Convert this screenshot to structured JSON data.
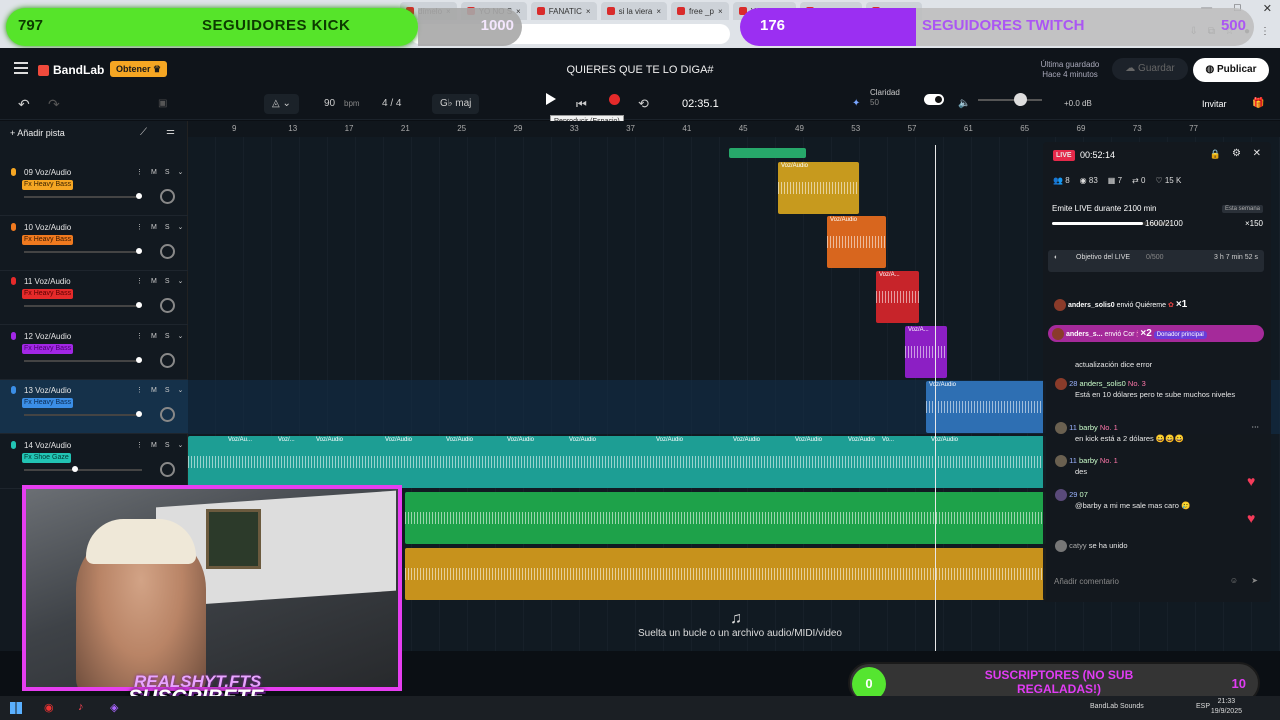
{
  "overlay": {
    "kick": {
      "count": "797",
      "label": "SEGUIDORES KICK",
      "goal": "1000"
    },
    "twitch": {
      "count": "176",
      "label": "SEGUIDORES TWITCH",
      "goal": "500"
    },
    "subs": {
      "count": "0",
      "label": "SUSCRIPTORES (NO SUB REGALADAS!)",
      "goal": "10"
    },
    "cam_handle": "REALSHYT.FTS",
    "cam_cta": "SUSCRIBETE"
  },
  "browser": {
    "tabs": [
      "dímelo",
      "YO NO S",
      "FANATIC",
      "si la viera",
      "free _p",
      "YO SOY",
      "VEN - V",
      "WASH"
    ]
  },
  "header": {
    "brand": "BandLab",
    "get_button": "Obtener",
    "title": "QUIERES QUE TE LO DIGA#",
    "saved_line1": "Última guardado",
    "saved_line2": "Hace 4 minutos",
    "save_button": "Guardar",
    "publish_button": "Publicar"
  },
  "transport": {
    "bpm_value": "90",
    "bpm_unit": "bpm",
    "time_signature": "4 / 4",
    "key": "G♭ maj",
    "time": "02:35.1",
    "tooltip": "Reproducir (Espacio)",
    "clarity_label": "Claridad",
    "clarity_value": "50",
    "volume_db": "+0.0 dB",
    "invite": "Invitar"
  },
  "add_track": "Añadir pista",
  "ruler": [
    "9",
    "13",
    "17",
    "21",
    "25",
    "29",
    "33",
    "37",
    "41",
    "45",
    "49",
    "53",
    "57",
    "61",
    "65",
    "69",
    "73",
    "77"
  ],
  "tracks": [
    {
      "num": "09",
      "name": "Voz/Audio",
      "fx": "Fx Heavy Bass",
      "fx_bg": "#f5a623",
      "fx_fg": "#3a2200",
      "mic": "#f5a623",
      "fader": 0.98
    },
    {
      "num": "10",
      "name": "Voz/Audio",
      "fx": "Fx Heavy Bass",
      "fx_bg": "#f07a1f",
      "fx_fg": "#3a1a00",
      "mic": "#f07a1f",
      "fader": 0.98
    },
    {
      "num": "11",
      "name": "Voz/Audio",
      "fx": "Fx Heavy Bass",
      "fx_bg": "#e52a2a",
      "fx_fg": "#5a0000",
      "mic": "#e52a2a",
      "fader": 0.98
    },
    {
      "num": "12",
      "name": "Voz/Audio",
      "fx": "Fx Heavy Bass",
      "fx_bg": "#a227e6",
      "fx_fg": "#4a0070",
      "mic": "#a227e6",
      "fader": 0.98
    },
    {
      "num": "13",
      "name": "Voz/Audio",
      "fx": "Fx Heavy Bass",
      "fx_bg": "#3b8ee6",
      "fx_fg": "#0a2a50",
      "mic": "#3b8ee6",
      "fader": 0.98
    },
    {
      "num": "14",
      "name": "Voz/Audio",
      "fx": "Fx Shoe Gaze",
      "fx_bg": "#22c4b4",
      "fx_fg": "#003a35",
      "mic": "#22c4b4",
      "fader": 0.42
    }
  ],
  "clip_label": "Voz/Audio",
  "clip_label_short": "Voz/A...",
  "lane14_labels": [
    "Voz/Au...",
    "Voz/...",
    "Voz/Audio",
    "Voz/Audio",
    "Voz/Audio",
    "Voz/Audio",
    "Voz/Audio",
    "Voz/Audio",
    "Voz/Audio",
    "Voz/Audio",
    "Voz/Audio",
    "Vo...",
    "Voz/Audio"
  ],
  "drop_hint": "Suelta un bucle o un archivo audio/MIDI/video",
  "chat": {
    "live": "LIVE",
    "elapsed": "00:52:14",
    "stats": [
      "8",
      "83",
      "7",
      "0",
      "15 K"
    ],
    "emite": "Emite LIVE durante 2100 min",
    "semana": "Esta semana",
    "progress_text": "1600/2100",
    "progress_fraction": 0.76,
    "multiplier": "×150",
    "objetivo": "Objetivo del LIVE",
    "objetivo_sub": "0/500",
    "objetivo_time": "3 h 7 min 52 s",
    "gift1_user": "anders_solis0",
    "gift1_text": "envió Quiéreme",
    "gift1_count": "×1",
    "gift2_user": "anders_s...",
    "gift2_text": "envió Cor",
    "gift2_count": "×2",
    "gift2_badge": "Donador principal",
    "m0": "actualización dice error",
    "m1_user": "anders_solis0",
    "m1_level": "28",
    "m1_badge": "No. 3",
    "m1_text": "Está en 10 dólares pero te sube muchos niveles",
    "m2_user": "barby",
    "m2_level": "11",
    "m2_badge": "No. 1",
    "m2_text": "en kick está a 2 dólares 😀😀😀",
    "m3_user": "barby",
    "m3_level": "11",
    "m3_badge": "No. 1",
    "m3_text": "des",
    "m4_user": "07",
    "m4_level": "29",
    "m4_text": "@barby a mi me sale mas caro 🥲",
    "m5_user": "catyy",
    "m5_text": "se ha unido",
    "comment_placeholder": "Añadir comentario"
  },
  "taskbar": {
    "lang": "ESP",
    "time": "21:33",
    "date": "19/9/2025",
    "bandlab_sounds": "BandLab Sounds"
  }
}
